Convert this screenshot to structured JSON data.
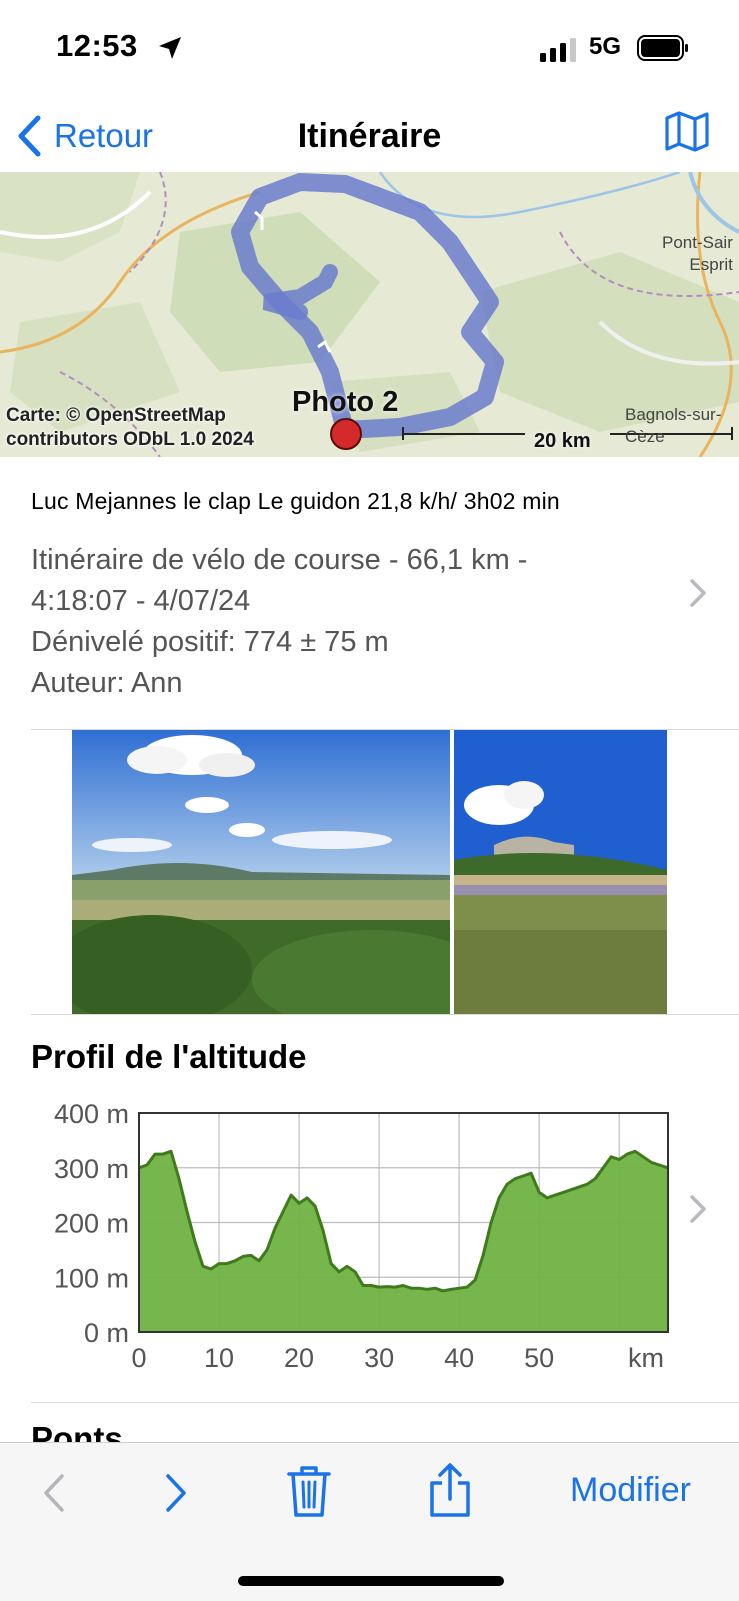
{
  "status": {
    "time": "12:53",
    "network": "5G"
  },
  "nav": {
    "back_label": "Retour",
    "title": "Itinéraire"
  },
  "map": {
    "attribution_line1": "Carte: © OpenStreetMap",
    "attribution_line2": "contributors ODbL 1.0 2024",
    "photo_label": "Photo 2",
    "scale_label": "20 km",
    "place_pont_line1": "Pont-Sair",
    "place_pont_line2": "Esprit",
    "place_bagnols_line1": "Bagnols-sur-",
    "place_bagnols_line2": "Cèze"
  },
  "route": {
    "title": "Luc Mejannes le clap Le guidon 21,8 k/h/ 3h02 min",
    "details_line1": "Itinéraire de vélo de course - 66,1 km -",
    "details_line2": "4:18:07 - 4/07/24",
    "elevation": "Dénivelé positif: 774 ± 75 m",
    "author": "Auteur: Ann"
  },
  "elevation_section": {
    "title": "Profil de l'altitude"
  },
  "chart_data": {
    "type": "area",
    "title": "Profil de l'altitude",
    "xlabel": "km",
    "ylabel": "",
    "xlim": [
      0,
      66.1
    ],
    "ylim": [
      0,
      400
    ],
    "x_ticks": [
      "0",
      "10",
      "20",
      "30",
      "40",
      "50"
    ],
    "x_unit_label": "km",
    "y_ticks": [
      "400 m",
      "300 m",
      "200 m",
      "100 m",
      "0 m"
    ],
    "grid": true,
    "color": "#6fb243",
    "line_color": "#3f7a1b",
    "series": [
      {
        "x": [
          0,
          1,
          2,
          3,
          4,
          5,
          6,
          7,
          8,
          9,
          10,
          11,
          12,
          13,
          14,
          15,
          16,
          17,
          18,
          19,
          20,
          21,
          22,
          23,
          24,
          25,
          26,
          27,
          28,
          29,
          30,
          31,
          32,
          33,
          34,
          35,
          36,
          37,
          38,
          39,
          40,
          41,
          42,
          43,
          44,
          45,
          46,
          47,
          48,
          49,
          50,
          51,
          52,
          53,
          54,
          55,
          56,
          57,
          58,
          59,
          60,
          61,
          62,
          63,
          64,
          65,
          66.1
        ],
        "values": [
          300,
          305,
          325,
          325,
          330,
          280,
          220,
          165,
          120,
          115,
          125,
          125,
          130,
          138,
          140,
          130,
          150,
          190,
          220,
          250,
          235,
          245,
          230,
          185,
          125,
          110,
          120,
          110,
          85,
          85,
          82,
          83,
          82,
          85,
          80,
          80,
          78,
          80,
          75,
          78,
          80,
          82,
          95,
          140,
          200,
          245,
          270,
          280,
          285,
          290,
          255,
          245,
          250,
          255,
          260,
          265,
          270,
          280,
          300,
          320,
          315,
          325,
          330,
          320,
          310,
          305,
          300
        ]
      }
    ]
  },
  "toolbar": {
    "edit_label": "Modifier"
  },
  "next_section": {
    "title": "Ponts"
  }
}
